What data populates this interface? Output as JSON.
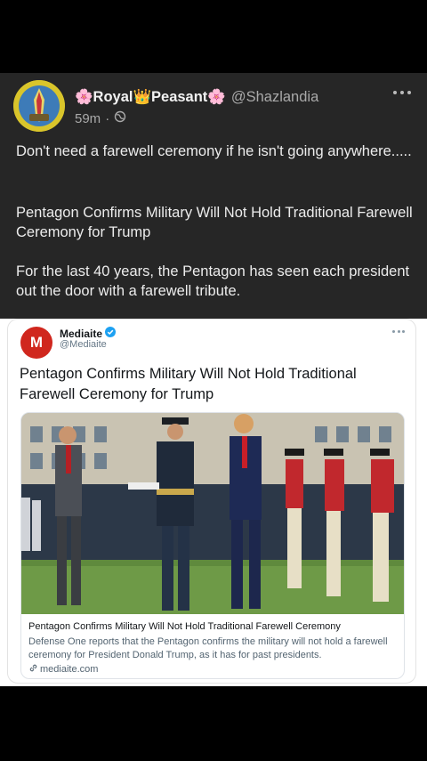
{
  "post": {
    "display_name": "🌸Royal👑Peasant🌸",
    "handle": "@Shazlandia",
    "time": "59m",
    "visibility_icon": "globe-icon",
    "text_1": "Don't need a farewell ceremony if he isn't going anywhere.....",
    "text_2": "Pentagon Confirms Military Will Not Hold Traditional Farewell Ceremony for Trump",
    "text_3": "For the last 40 years, the Pentagon has seen each president out the door with a farewell tribute."
  },
  "embed": {
    "logo_letter": "M",
    "source_name": "Mediaite",
    "source_handle": "@Mediaite",
    "headline": "Pentagon Confirms Military Will Not Hold Traditional Farewell Ceremony for Trump",
    "preview_title": "Pentagon Confirms Military Will Not Hold Traditional Farewell Ceremony",
    "preview_description": "Defense One reports that the Pentagon confirms the military will not hold a farewell ceremony for President Donald Trump, as it has for past presidents.",
    "preview_domain": "mediaite.com"
  },
  "colors": {
    "post_background": "#262626",
    "brand_red": "#d0271e",
    "verified_blue": "#1da1f2"
  }
}
